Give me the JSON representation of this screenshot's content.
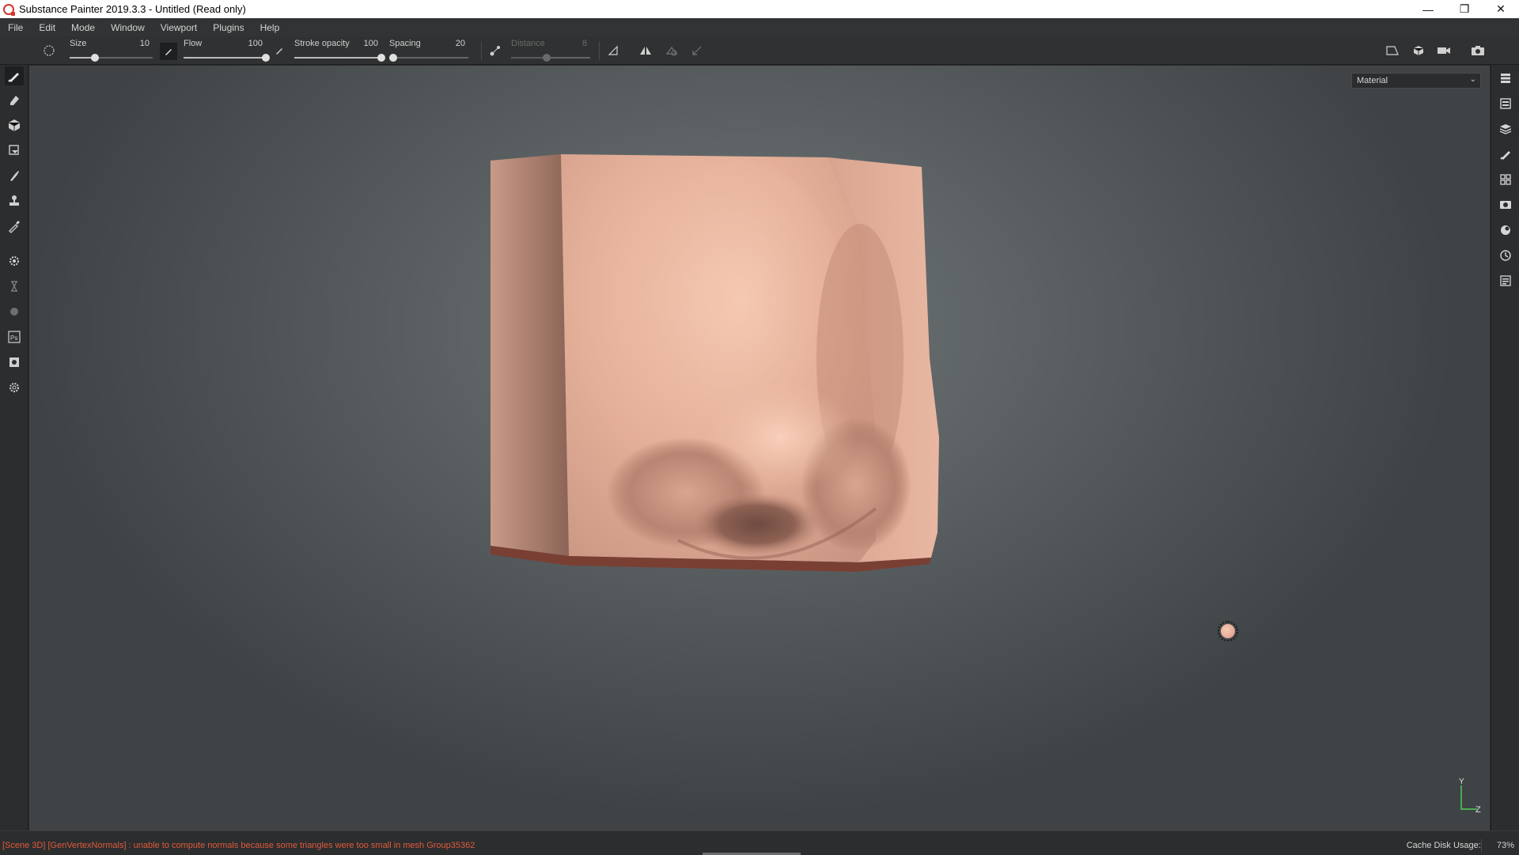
{
  "window": {
    "title": "Substance Painter 2019.3.3 - Untitled (Read only)",
    "controls": [
      "minimize-icon",
      "restore-icon",
      "close-icon"
    ]
  },
  "menu": [
    "File",
    "Edit",
    "Mode",
    "Window",
    "Viewport",
    "Plugins",
    "Help"
  ],
  "tool_options": {
    "size": {
      "label": "Size",
      "value": "10",
      "fraction": 0.3
    },
    "flow": {
      "label": "Flow",
      "value": "100",
      "fraction": 1.0
    },
    "stroke_opacity": {
      "label": "Stroke opacity",
      "value": "100",
      "fraction": 1.0
    },
    "spacing": {
      "label": "Spacing",
      "value": "20",
      "fraction": 0.05
    },
    "distance": {
      "label": "Distance",
      "value": "8",
      "fraction": 0.45,
      "enabled": false
    }
  },
  "left_tools": [
    "paint-brush-icon",
    "eraser-icon",
    "projection-icon",
    "polygon-fill-icon",
    "smudge-icon",
    "clone-stamp-icon",
    "color-picker-icon",
    "bake-settings-icon",
    "iray-icon",
    "plugin-icon",
    "photoshop-export-icon",
    "export-icon",
    "settings-icon"
  ],
  "right_tools": [
    "layers-stack-icon",
    "texture-set-list-icon",
    "layers-icon",
    "properties-icon",
    "shelf-icon",
    "display-settings-icon",
    "shader-settings-icon",
    "history-icon",
    "log-icon"
  ],
  "viewport": {
    "mode_dropdown": "Material",
    "axis_labels": {
      "y": "Y",
      "z": "Z"
    }
  },
  "status": {
    "message": "[Scene 3D] [GenVertexNormals] : unable to compute normals because some triangles were too small in mesh Group35362",
    "cache_label": "Cache Disk Usage:",
    "cache_value": "73%"
  },
  "colors": {
    "accent_error": "#e05b3b",
    "skin": "#e9b29a"
  }
}
